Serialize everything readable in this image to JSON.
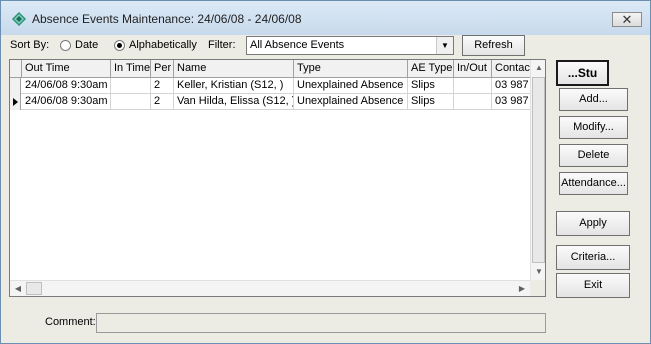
{
  "window": {
    "title": "Absence Events Maintenance: 24/06/08 - 24/06/08",
    "close_glyph": "✕"
  },
  "toolbar": {
    "sort_by_label": "Sort By:",
    "sort_options": [
      {
        "label": "Date",
        "checked": false
      },
      {
        "label": "Alphabetically",
        "checked": true
      }
    ],
    "filter_label": "Filter:",
    "filter_value": "All Absence Events",
    "refresh_label": "Refresh"
  },
  "grid": {
    "columns": [
      "Out Time",
      "In Time",
      "Per",
      "Name",
      "Type",
      "AE Type",
      "In/Out",
      "Contac"
    ],
    "rows": [
      {
        "selected": false,
        "cells": [
          "24/06/08 9:30am",
          "",
          "2",
          "Keller, Kristian (S12, )",
          "Unexplained Absence",
          "Slips",
          "",
          "03 987"
        ]
      },
      {
        "selected": true,
        "cells": [
          "24/06/08 9:30am",
          "",
          "2",
          "Van Hilda, Elissa (S12, )",
          "Unexplained Absence",
          "Slips",
          "",
          "03 987"
        ]
      }
    ]
  },
  "side_buttons": {
    "stu": "...Stu",
    "add": "Add...",
    "modify": "Modify...",
    "delete": "Delete",
    "attendance": "Attendance...",
    "apply": "Apply",
    "criteria": "Criteria...",
    "exit": "Exit"
  },
  "comment": {
    "label": "Comment:",
    "value": ""
  },
  "icons": [
    "app-diamond-icon",
    "close-icon",
    "dropdown-arrow-icon",
    "row-pointer-icon",
    "scroll-up-icon",
    "scroll-down-icon",
    "scroll-left-icon",
    "scroll-right-icon"
  ]
}
